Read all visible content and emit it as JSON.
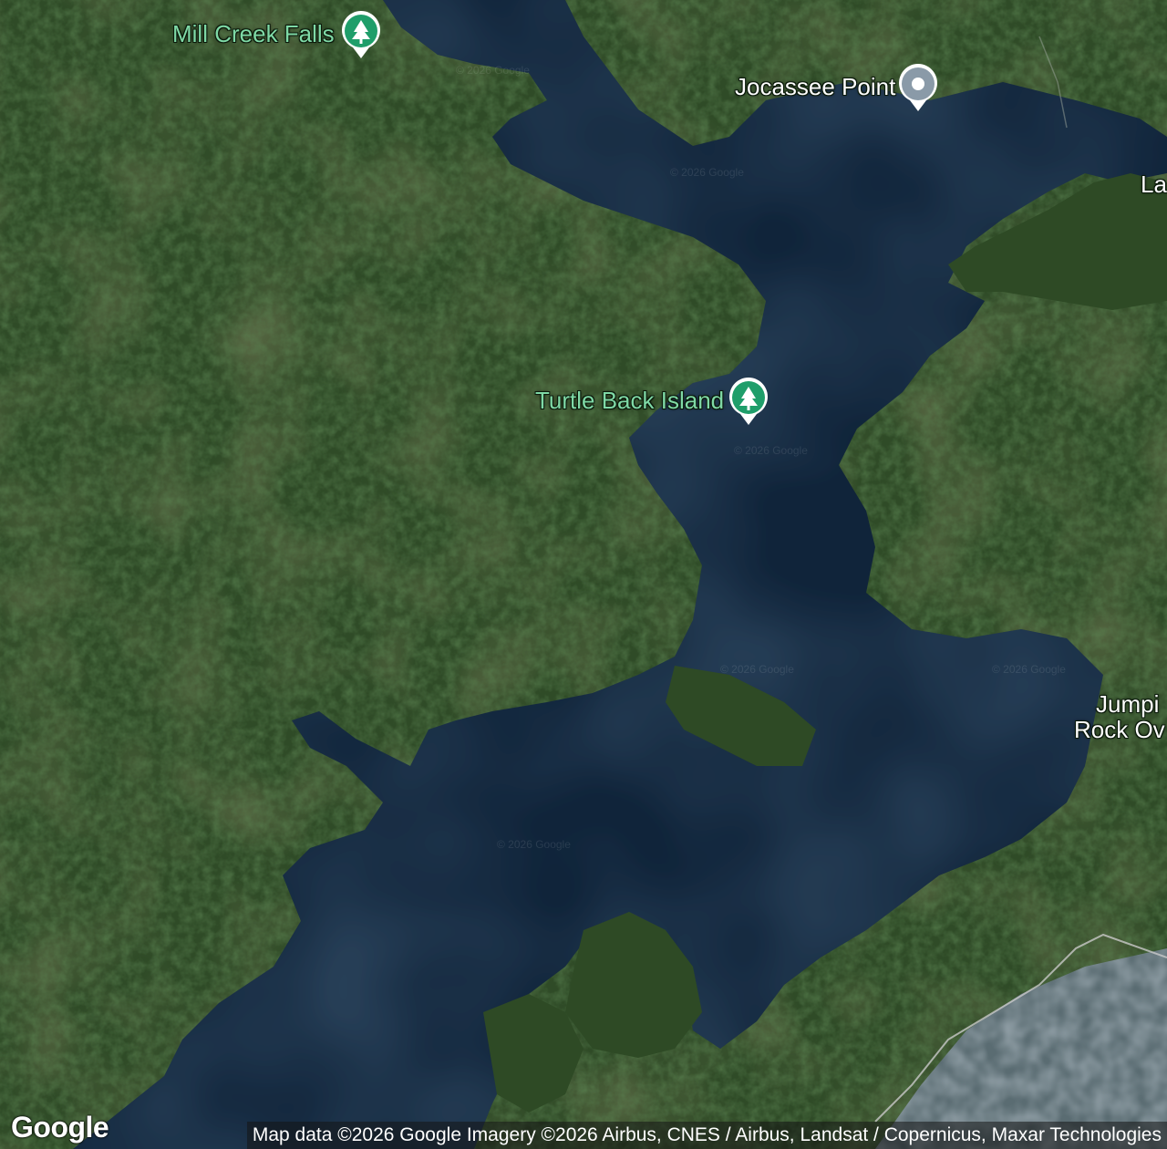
{
  "map": {
    "type": "satellite",
    "colors": {
      "water": "#0f2236",
      "forest": "#2d4a26",
      "park_marker": "#1f9e6a",
      "poi_marker": "#8a9aa8",
      "park_label": "#7fd9a6"
    }
  },
  "places": [
    {
      "name": "Mill Creek Falls",
      "icon": "tree-icon",
      "kind": "park"
    },
    {
      "name": "Jocassee Point",
      "icon": "dot-icon",
      "kind": "poi"
    },
    {
      "name": "Turtle Back Island",
      "icon": "tree-icon",
      "kind": "park"
    }
  ],
  "edge_labels": {
    "top_right": "La",
    "right_line1": "Jumpi",
    "right_line2": "Rock Ov"
  },
  "watermark": "© 2026 Google",
  "logo": "Google",
  "attribution": "Map data ©2026 Google Imagery ©2026 Airbus, CNES / Airbus, Landsat / Copernicus, Maxar Technologies"
}
